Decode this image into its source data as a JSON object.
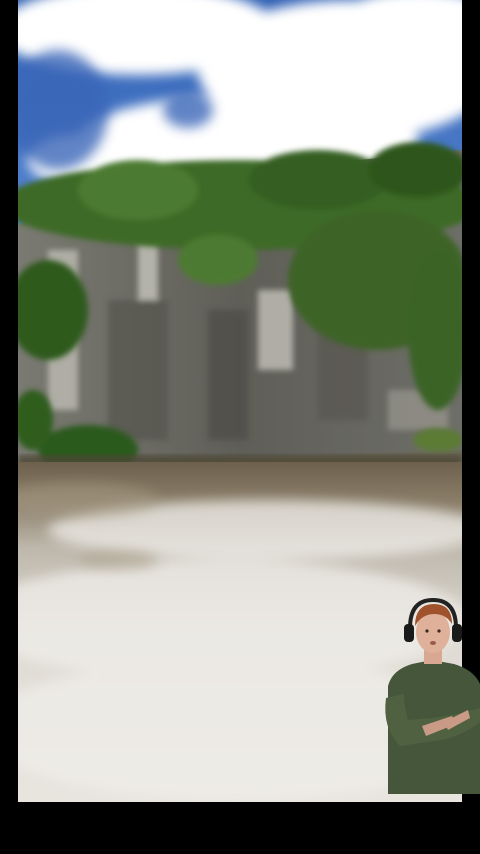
{
  "screen": {
    "background": "#000000"
  },
  "video": {
    "description_colors": {
      "sky": "#3f73c4",
      "cloud": "#ffffff",
      "foliage": "#3f6b2a",
      "cliff": "#6f6f68",
      "water": "#8a7f6c",
      "foam": "#e6e6e2"
    }
  },
  "webcam": {
    "icon": "headphones-icon",
    "shirt_color": "#46563a",
    "hair_color": "#a0522d"
  }
}
